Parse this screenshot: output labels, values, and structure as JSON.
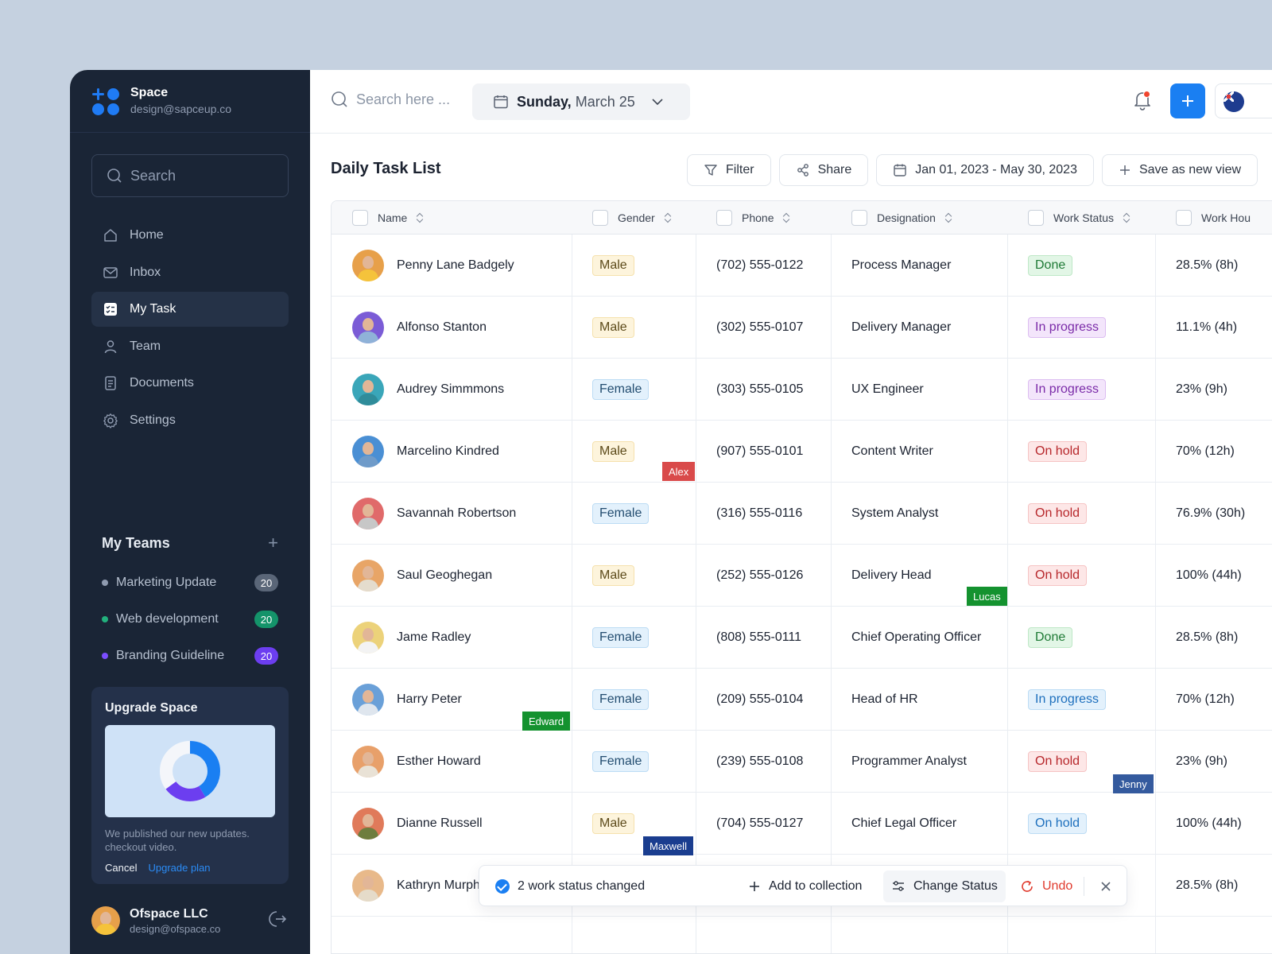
{
  "brand": {
    "name": "Space",
    "email": "design@sapceup.co"
  },
  "sidebar": {
    "search_placeholder": "Search",
    "items": [
      {
        "label": "Home",
        "icon": "home-icon",
        "active": false
      },
      {
        "label": "Inbox",
        "icon": "mail-icon",
        "active": false
      },
      {
        "label": "My Task",
        "icon": "task-list-icon",
        "active": true
      },
      {
        "label": "Team",
        "icon": "user-icon",
        "active": false
      },
      {
        "label": "Documents",
        "icon": "document-icon",
        "active": false
      },
      {
        "label": "Settings",
        "icon": "gear-icon",
        "active": false
      }
    ],
    "teams_title": "My Teams",
    "teams": [
      {
        "name": "Marketing Update",
        "count": "20",
        "dot": "#8f9bb0",
        "badge": "#5a6678"
      },
      {
        "name": "Web development",
        "count": "20",
        "dot": "#22b07d",
        "badge": "#14936a"
      },
      {
        "name": "Branding Guideline",
        "count": "20",
        "dot": "#7b4dff",
        "badge": "#6c3ef0"
      }
    ],
    "upgrade": {
      "title": "Upgrade Space",
      "text": "We published our new updates. checkout video.",
      "cancel": "Cancel",
      "plan": "Upgrade plan"
    },
    "profile": {
      "name": "Ofspace LLC",
      "email": "design@ofspace.co"
    }
  },
  "topbar": {
    "search_placeholder": "Search here ...",
    "date_day": "Sunday,",
    "date_rest": "March 25"
  },
  "page": {
    "title": "Daily Task List",
    "filter": "Filter",
    "share": "Share",
    "range": "Jan 01, 2023 - May 30, 2023",
    "save_view": "Save as new view"
  },
  "table": {
    "columns": [
      "Name",
      "Gender",
      "Phone",
      "Designation",
      "Work Status",
      "Work Hou"
    ],
    "rows": [
      {
        "name": "Penny Lane Badgely",
        "gender": "Male",
        "phone": "(702) 555-0122",
        "designation": "Process Manager",
        "status": "Done",
        "status_style": "done",
        "hours": "28.5% (8h)",
        "avatar": "#e7a04a",
        "shirt": "#f5c33b"
      },
      {
        "name": "Alfonso Stanton",
        "gender": "Male",
        "phone": "(302) 555-0107",
        "designation": "Delivery Manager",
        "status": "In progress",
        "status_style": "prog",
        "hours": "11.1% (4h)",
        "avatar": "#7b5cd6",
        "shirt": "#8fb2d8"
      },
      {
        "name": "Audrey Simmmons",
        "gender": "Female",
        "phone": "(303) 555-0105",
        "designation": "UX Engineer",
        "status": "In progress",
        "status_style": "prog",
        "hours": "23% (9h)",
        "avatar": "#3aa6b9",
        "shirt": "#2f8c9a"
      },
      {
        "name": "Marcelino Kindred",
        "gender": "Male",
        "phone": "(907) 555-0101",
        "designation": "Content Writer",
        "status": "On hold",
        "status_style": "hold",
        "hours": "70% (12h)",
        "avatar": "#4a8fd4",
        "shirt": "#6f9bc9"
      },
      {
        "name": "Savannah Robertson",
        "gender": "Female",
        "phone": "(316) 555-0116",
        "designation": "System Analyst",
        "status": "On hold",
        "status_style": "hold",
        "hours": "76.9% (30h)",
        "avatar": "#e06a6a",
        "shirt": "#c7c7c7"
      },
      {
        "name": "Saul Geoghegan",
        "gender": "Male",
        "phone": "(252) 555-0126",
        "designation": "Delivery Head",
        "status": "On hold",
        "status_style": "hold",
        "hours": "100% (44h)",
        "avatar": "#e8a567",
        "shirt": "#e4dccd"
      },
      {
        "name": "Jame Radley",
        "gender": "Female",
        "phone": "(808) 555-0111",
        "designation": "Chief Operating Officer",
        "status": "Done",
        "status_style": "done",
        "hours": "28.5% (8h)",
        "avatar": "#ecd27a",
        "shirt": "#f3f3f3"
      },
      {
        "name": "Harry Peter",
        "gender": "Female",
        "phone": "(209) 555-0104",
        "designation": "Head of HR",
        "status": "In progress",
        "status_style": "prog2",
        "hours": "70% (12h)",
        "avatar": "#6aa0d8",
        "shirt": "#dfe6ee"
      },
      {
        "name": "Esther Howard",
        "gender": "Female",
        "phone": "(239) 555-0108",
        "designation": "Programmer Analyst",
        "status": "On hold",
        "status_style": "hold",
        "hours": "23% (9h)",
        "avatar": "#e8a06a",
        "shirt": "#e9e2d6"
      },
      {
        "name": "Dianne Russell",
        "gender": "Male",
        "phone": "(704) 555-0127",
        "designation": "Chief Legal Officer",
        "status": "On hold",
        "status_style": "hold2",
        "hours": "100% (44h)",
        "avatar": "#e07a5a",
        "shirt": "#6e7d3e"
      },
      {
        "name": "Kathryn Murph",
        "gender": "",
        "phone": "",
        "designation": "",
        "status": "",
        "status_style": "",
        "hours": "28.5% (8h)",
        "avatar": "#e8b98a",
        "shirt": "#e5dbc9"
      }
    ],
    "cursors": [
      {
        "name": "Alex",
        "color": "#d94a4a"
      },
      {
        "name": "Lucas",
        "color": "#14922f"
      },
      {
        "name": "Edward",
        "color": "#14922f"
      },
      {
        "name": "Jenny",
        "color": "#345a9e"
      },
      {
        "name": "Maxwell",
        "color": "#1a3d8f"
      }
    ]
  },
  "snackbar": {
    "message": "2 work status changed",
    "add": "Add to collection",
    "change": "Change Status",
    "undo": "Undo"
  }
}
